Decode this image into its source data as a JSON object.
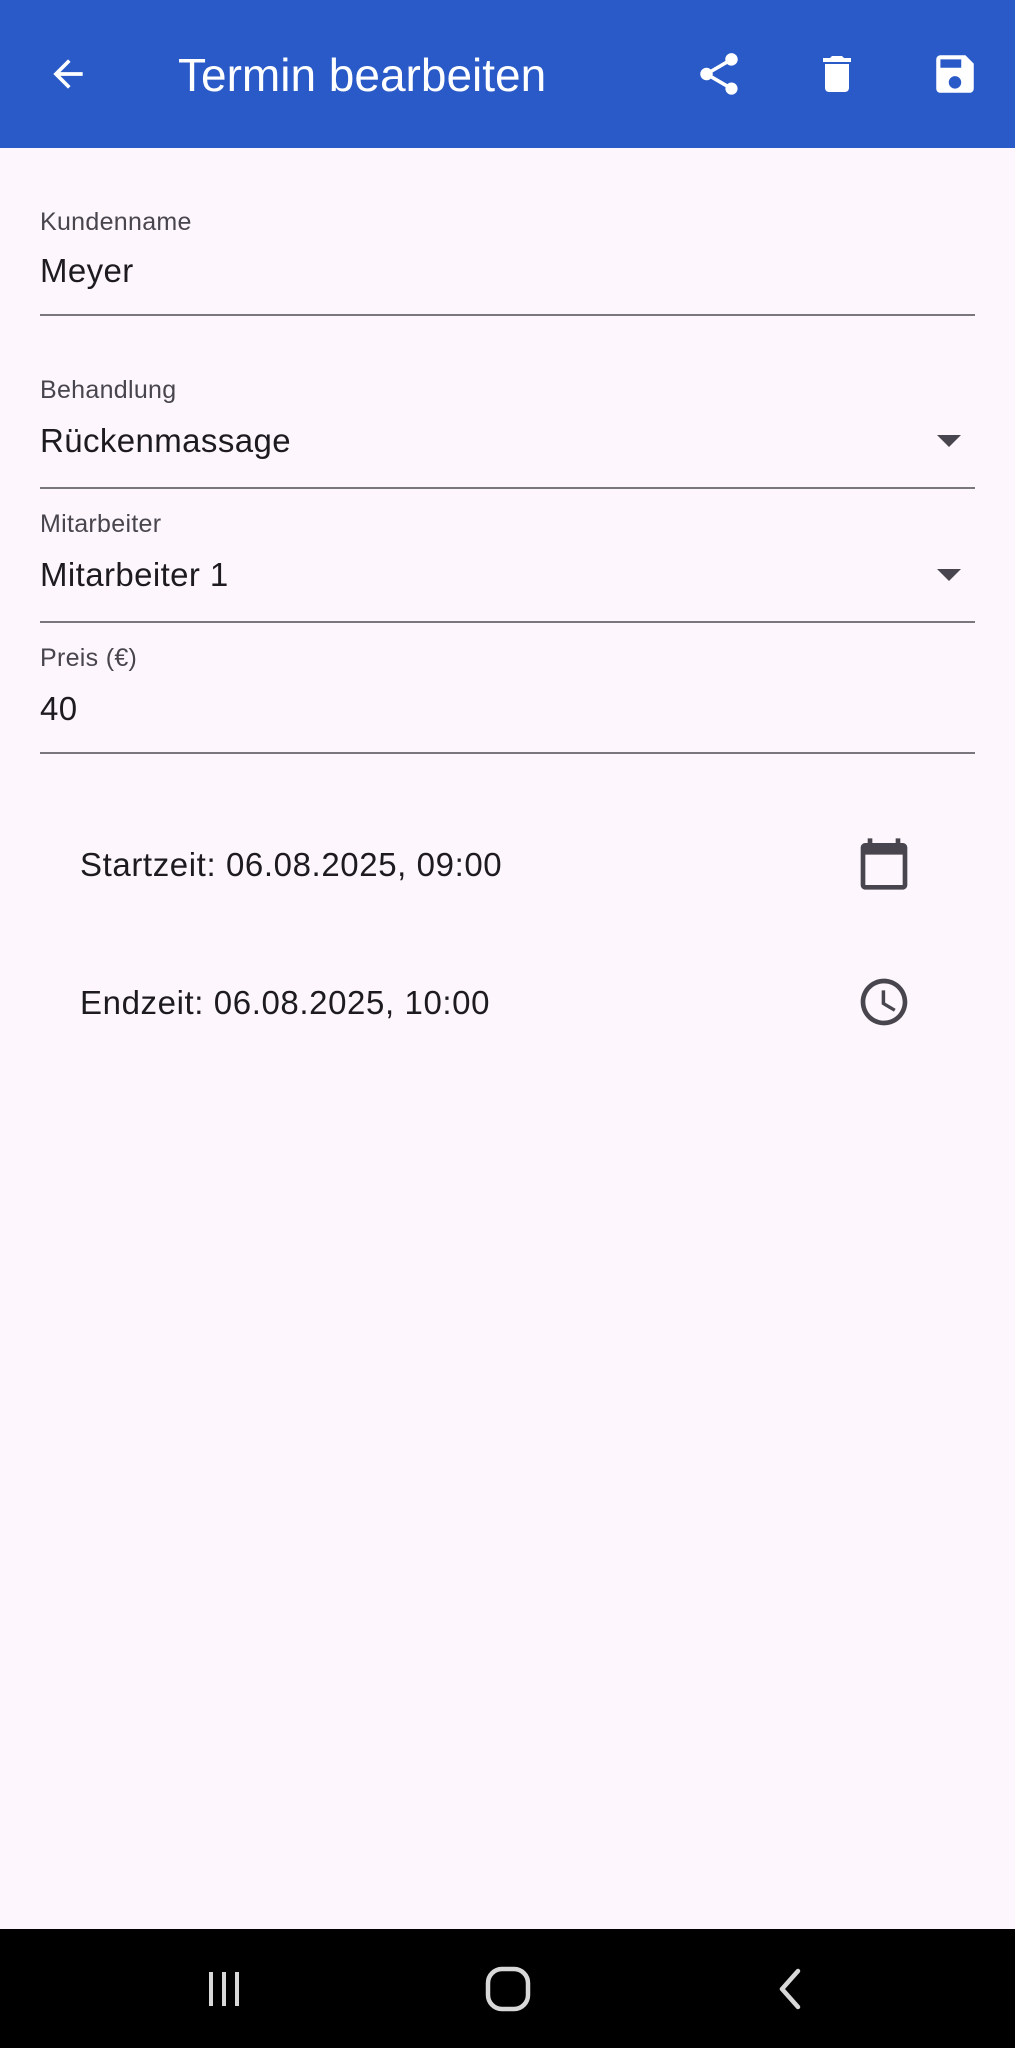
{
  "app_bar": {
    "title": "Termin bearbeiten",
    "background_color": "#2a5ac8",
    "icons": {
      "back": "arrow-left-icon",
      "share": "share-icon",
      "delete": "trash-icon",
      "save": "floppy-disk-icon"
    }
  },
  "form": {
    "customer": {
      "label": "Kundenname",
      "value": "Meyer"
    },
    "treatment": {
      "label": "Behandlung",
      "value": "Rückenmassage",
      "icon": "dropdown-arrow-icon"
    },
    "employee": {
      "label": "Mitarbeiter",
      "value": "Mitarbeiter 1",
      "icon": "dropdown-arrow-icon"
    },
    "price": {
      "label": "Preis (€)",
      "value": "40"
    }
  },
  "times": {
    "start": {
      "text": "Startzeit: 06.08.2025, 09:00",
      "icon": "calendar-icon"
    },
    "end": {
      "text": "Endzeit: 06.08.2025, 10:00",
      "icon": "clock-icon"
    }
  },
  "system_nav": {
    "icons": {
      "recents": "recent-apps-icon",
      "home": "home-icon",
      "back": "back-chevron-icon"
    }
  },
  "colors": {
    "page_background": "#fdf6fd",
    "text": "#1d1b20",
    "label": "#48454e",
    "underline": "#79767d"
  }
}
